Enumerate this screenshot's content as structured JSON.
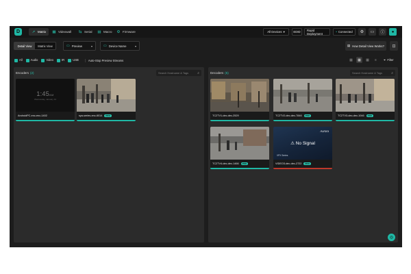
{
  "app": {
    "logo_letter": "D",
    "nav_tabs": [
      {
        "label": "Matrix",
        "icon": "send-icon",
        "glyph": "➚",
        "active": true
      },
      {
        "label": "Videowall",
        "icon": "grid-icon",
        "glyph": "▦",
        "active": false
      },
      {
        "label": "Serial",
        "icon": "serial-icon",
        "glyph": "⇆",
        "active": false
      },
      {
        "label": "Macro",
        "icon": "macro-icon",
        "glyph": "▤",
        "active": false
      },
      {
        "label": "Firmware",
        "icon": "firmware-icon",
        "glyph": "⚙",
        "active": false
      }
    ],
    "device_filter": "All Devices",
    "edid_label": "EDID",
    "rapid_label": "Rapid Deployment",
    "status_label": "Connected",
    "accent": "#1fb8a5"
  },
  "toolbar": {
    "view_detail": "Detail View",
    "view_matrix": "Matrix View",
    "preview_label": "Preview",
    "device_name_label": "Device Name",
    "how_label": "How Detail View Works?"
  },
  "filters": {
    "items": [
      "All",
      "Audio",
      "Video",
      "IR",
      "USB"
    ],
    "autostop": "Auto-Stop Preview Streams",
    "filter_label": "Filter"
  },
  "encoders": {
    "title": "Encoders",
    "count": "(2)",
    "search_placeholder": "Search Hostname & Tags",
    "cards": [
      {
        "name": "AndroidPC-enc-enc-1402",
        "pro": false,
        "type": "clock",
        "time": "1:45",
        "ampm": "AM",
        "date": "Wednesday, January 31"
      },
      {
        "name": "sya-series-enc-6014",
        "pro": true,
        "type": "scene"
      }
    ]
  },
  "decoders": {
    "title": "Decoders",
    "count": "(5)",
    "search_placeholder": "Search Hostname & Tags",
    "cards": [
      {
        "name": "TC2TV1-dec-dec-2529",
        "pro": false,
        "type": "scene"
      },
      {
        "name": "TC2TV2-dec-dec-7846",
        "pro": true,
        "type": "scene"
      },
      {
        "name": "TC2TV3-dec-dec-1046",
        "pro": true,
        "type": "scene"
      },
      {
        "name": "TC2TV4-dec-dec-1466",
        "pro": true,
        "type": "scene"
      },
      {
        "name": "VIDEO3-dec-dec-2722",
        "pro": true,
        "type": "nosignal",
        "brand": "Aurora",
        "message": "No Signal",
        "series": "VPX Series"
      }
    ]
  },
  "badge_label": "PRO"
}
